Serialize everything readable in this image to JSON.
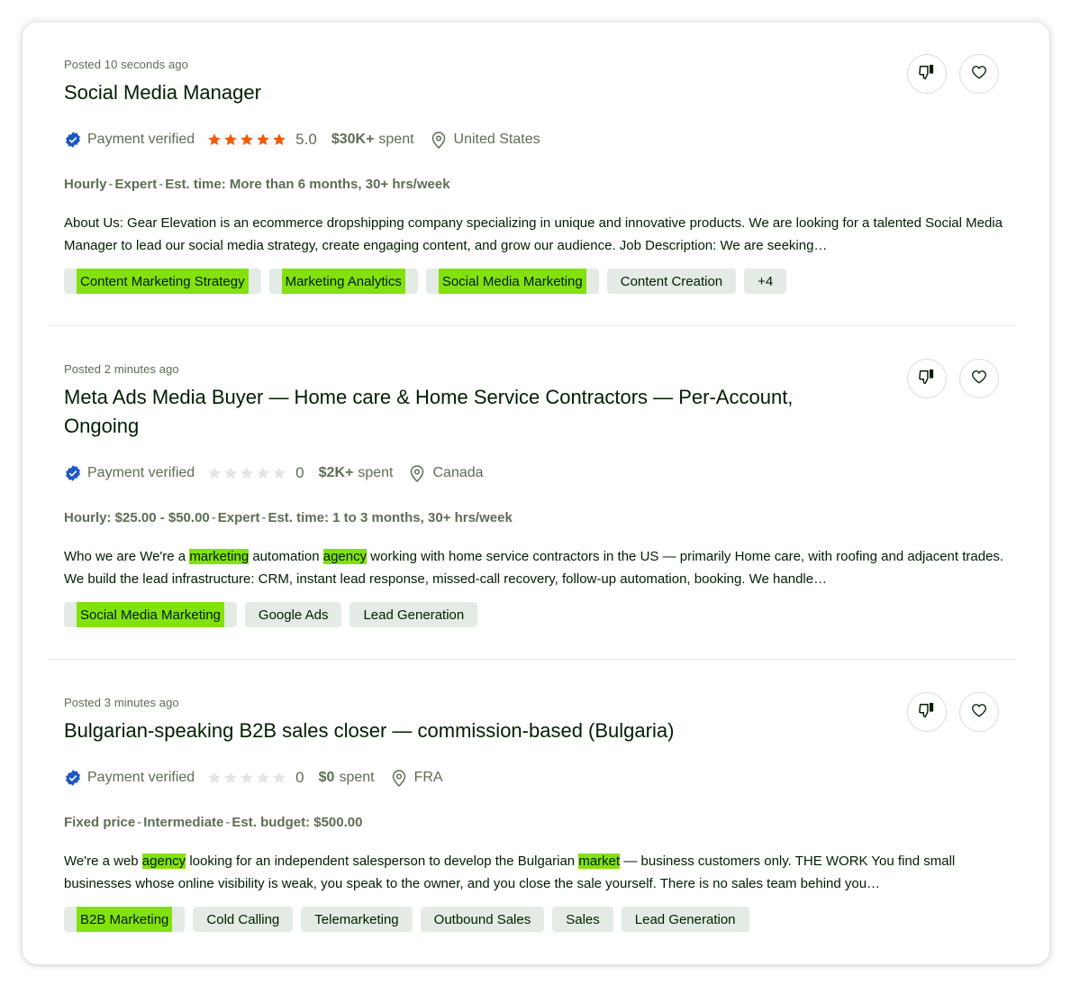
{
  "jobs": [
    {
      "posted": "Posted 10 seconds ago",
      "title": "Social Media Manager",
      "verified": "Payment verified",
      "rating_value": 5,
      "rating_text": "5.0",
      "spent_amount": "$30K+",
      "spent_label": "spent",
      "location": "United States",
      "terms": [
        "Hourly",
        "Expert",
        "Est. time: More than 6 months, 30+ hrs/week"
      ],
      "description": [
        {
          "text": "About Us: Gear Elevation is an ecommerce dropshipping company specializing in unique and innovative products. We are looking for a talented Social Media Manager to lead our social media strategy, create engaging content, and grow our audience. Job Description: We are seeking…",
          "hl": false
        }
      ],
      "tags": [
        {
          "label": "Content Marketing Strategy",
          "hl": true
        },
        {
          "label": "Marketing Analytics",
          "hl": true
        },
        {
          "label": "Social Media Marketing",
          "hl": true
        },
        {
          "label": "Content Creation",
          "hl": false
        },
        {
          "label": "+4",
          "hl": false
        }
      ]
    },
    {
      "posted": "Posted 2 minutes ago",
      "title": "Meta Ads Media Buyer — Home care & Home Service Contractors — Per-Account, Ongoing",
      "verified": "Payment verified",
      "rating_value": 0,
      "rating_text": "0",
      "spent_amount": "$2K+",
      "spent_label": "spent",
      "location": "Canada",
      "terms": [
        "Hourly: $25.00 - $50.00",
        "Expert",
        "Est. time: 1 to 3 months, 30+ hrs/week"
      ],
      "description": [
        {
          "text": "Who we are We're a ",
          "hl": false
        },
        {
          "text": "marketing",
          "hl": true
        },
        {
          "text": " automation ",
          "hl": false
        },
        {
          "text": "agency",
          "hl": true
        },
        {
          "text": " working with home service contractors in the US — primarily Home care, with roofing and adjacent trades. We build the lead infrastructure: CRM, instant lead response, missed-call recovery, follow-up automation, booking. We handle…",
          "hl": false
        }
      ],
      "tags": [
        {
          "label": "Social Media Marketing",
          "hl": true
        },
        {
          "label": "Google Ads",
          "hl": false
        },
        {
          "label": "Lead Generation",
          "hl": false
        }
      ]
    },
    {
      "posted": "Posted 3 minutes ago",
      "title": "Bulgarian-speaking B2B sales closer — commission-based (Bulgaria)",
      "verified": "Payment verified",
      "rating_value": 0,
      "rating_text": "0",
      "spent_amount": "$0",
      "spent_label": "spent",
      "location": "FRA",
      "terms": [
        "Fixed price",
        "Intermediate",
        "Est. budget: $500.00"
      ],
      "description": [
        {
          "text": "We're a web ",
          "hl": false
        },
        {
          "text": "agency",
          "hl": true
        },
        {
          "text": " looking for an independent salesperson to develop the Bulgarian ",
          "hl": false
        },
        {
          "text": "market",
          "hl": true
        },
        {
          "text": " — business customers only. THE WORK You find small businesses whose online visibility is weak, you speak to the owner, and you close the sale yourself. There is no sales team behind you…",
          "hl": false
        }
      ],
      "tags": [
        {
          "label": "B2B Marketing",
          "hl": true
        },
        {
          "label": "Cold Calling",
          "hl": false
        },
        {
          "label": "Telemarketing",
          "hl": false
        },
        {
          "label": "Outbound Sales",
          "hl": false
        },
        {
          "label": "Sales",
          "hl": false
        },
        {
          "label": "Lead Generation",
          "hl": false
        }
      ]
    }
  ],
  "colors": {
    "highlight": "#82e10e",
    "star_filled": "#f25c05",
    "star_empty": "#e0e6e0",
    "verified_badge": "#1f57c3"
  },
  "icons": [
    "dislike-icon",
    "heart-icon",
    "verified-badge-icon",
    "star-icon",
    "location-pin-icon"
  ]
}
